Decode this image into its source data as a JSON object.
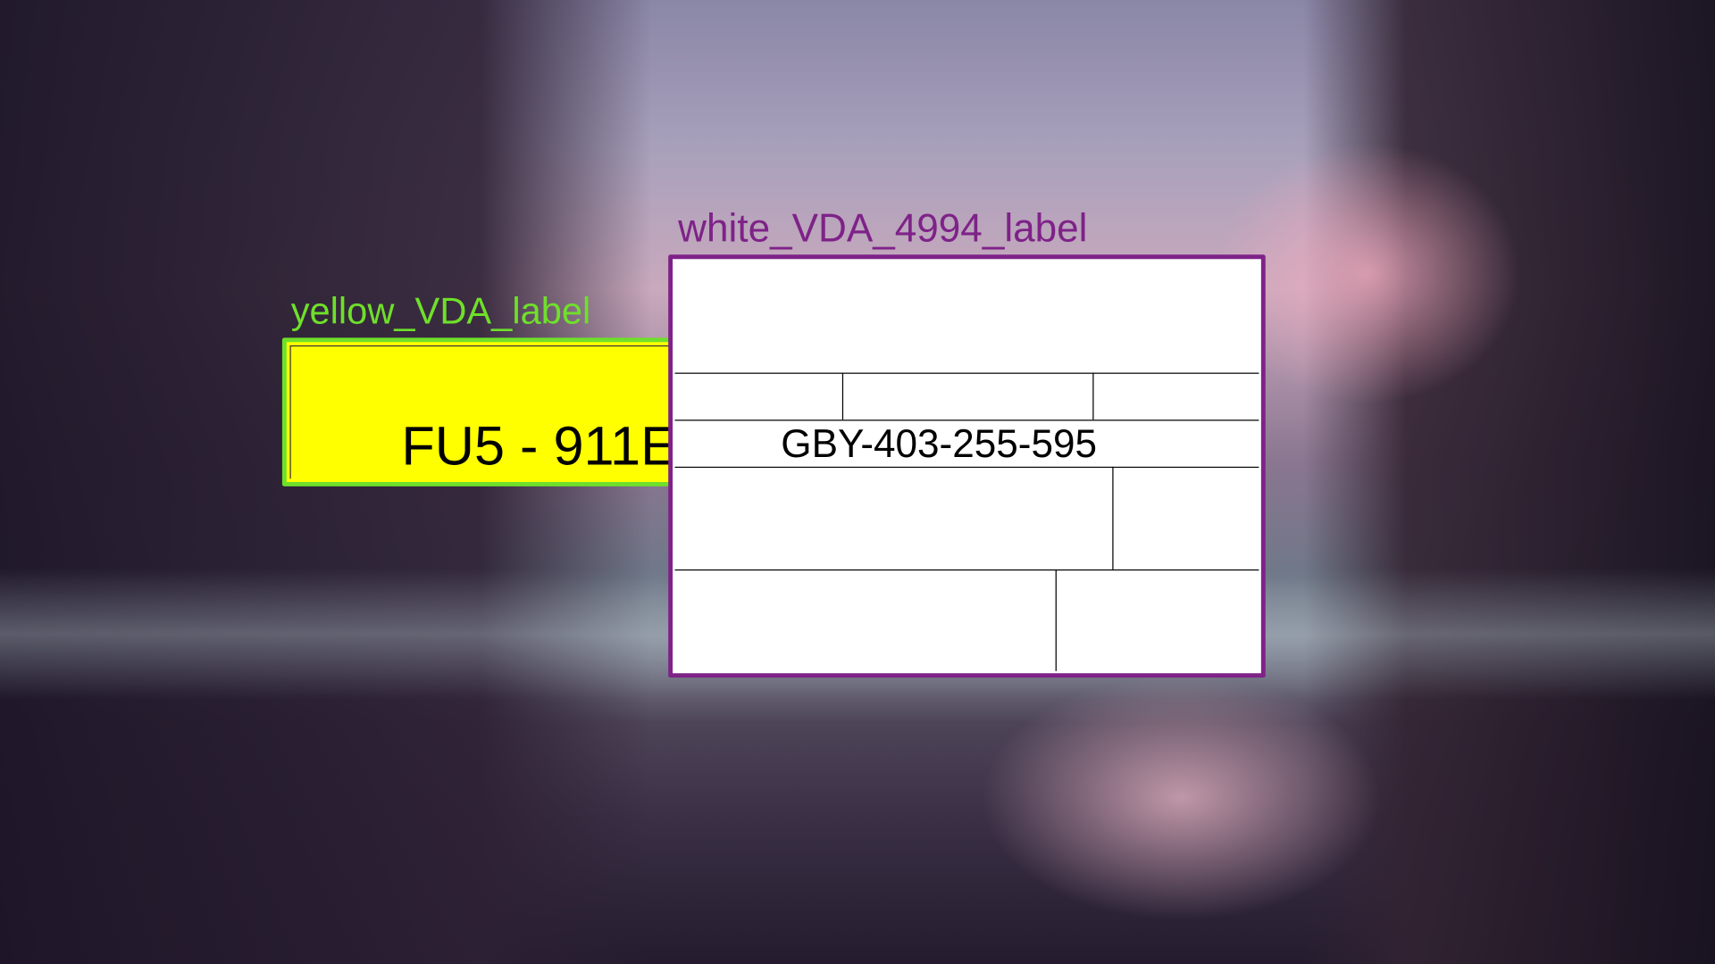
{
  "background": {
    "description_icon": "landscape-wallpaper"
  },
  "annotations": [
    {
      "title": "yellow_VDA_label",
      "color": "#6fe02a",
      "fill": "#ffff00",
      "text": "FU5 - 911E"
    },
    {
      "title": "white_VDA_4994_label",
      "color": "#7e2288",
      "fill": "#ffffff",
      "text": "GBY-403-255-595"
    }
  ]
}
